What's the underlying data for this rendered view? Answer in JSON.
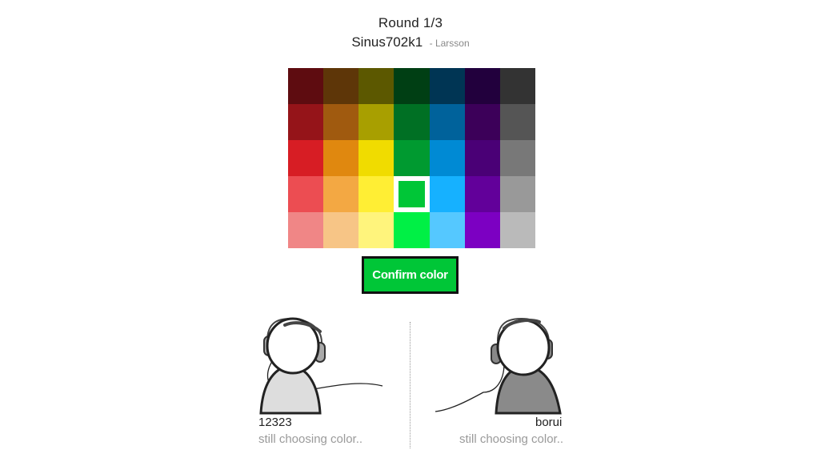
{
  "header": {
    "round": "Round 1/3",
    "song_title": "Sinus702k1",
    "song_artist": "- Larsson"
  },
  "palette": {
    "rows": [
      [
        "#5e0c10",
        "#5e3608",
        "#5c5800",
        "#003f14",
        "#003554",
        "#22003d",
        "#333333"
      ],
      [
        "#951419",
        "#a05a0f",
        "#a89f00",
        "#007024",
        "#00629b",
        "#3c0059",
        "#555555"
      ],
      [
        "#d71d24",
        "#e0880f",
        "#f0dc00",
        "#009a30",
        "#008ad4",
        "#4a0076",
        "#787878"
      ],
      [
        "#ec4d52",
        "#f3a843",
        "#ffee34",
        "#00c637",
        "#16b1ff",
        "#62009a",
        "#999999"
      ],
      [
        "#f08686",
        "#f7c586",
        "#fff47c",
        "#00f045",
        "#55c8ff",
        "#7c00c2",
        "#bababa"
      ]
    ],
    "selected": [
      3,
      3
    ]
  },
  "confirm": {
    "label": "Confirm color",
    "color": "#00c637"
  },
  "players": [
    {
      "name": "12323",
      "status": "still choosing color..",
      "body_color": "#dddddd"
    },
    {
      "name": "borui",
      "status": "still choosing color..",
      "body_color": "#8a8a8a"
    }
  ]
}
